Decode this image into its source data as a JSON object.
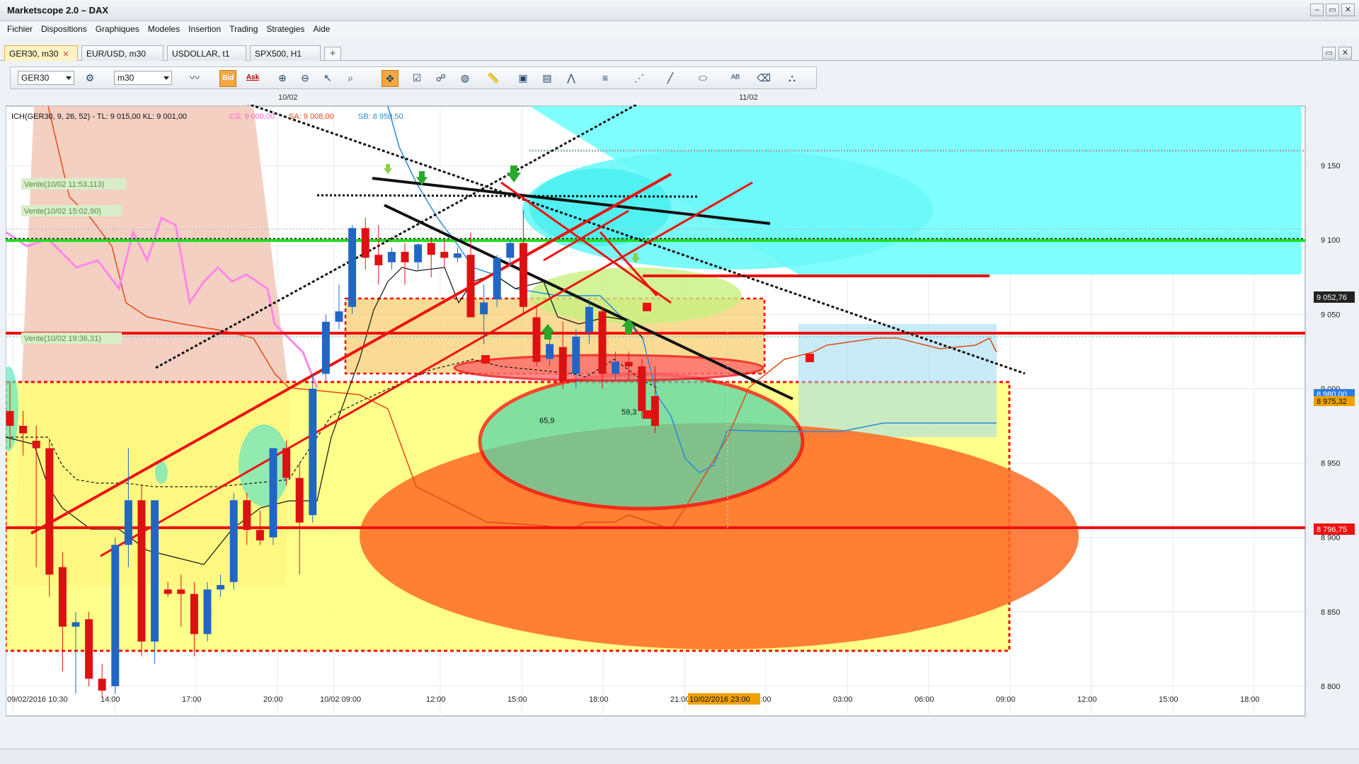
{
  "window": {
    "title": "Marketscope 2.0 – DAX"
  },
  "menu": [
    "Fichier",
    "Dispositions",
    "Graphiques",
    "Modeles",
    "Insertion",
    "Trading",
    "Strategies",
    "Aide"
  ],
  "tabs": [
    {
      "label": "GER30, m30",
      "close": "✕"
    },
    {
      "label": "EUR/USD, m30"
    },
    {
      "label": "USDOLLAR, t1"
    },
    {
      "label": "SPX500, H1"
    }
  ],
  "toolbar": {
    "instrument": "GER30",
    "timeframe": "m30",
    "bid_label": "Bid",
    "ask_label": "Ask"
  },
  "chart": {
    "indicator": "ICH(GER30, 9, 26, 52) -   TL: 9 015,00   KL: 9 001,00",
    "indicator_cs": "CS: 9 000,00",
    "indicator_sa": "SA: 9 008,00",
    "indicator_sb": "SB: 8 950,50",
    "date_markers": [
      "10/02",
      "11/02"
    ],
    "trade_labels": [
      "Vente(10/02 11:53,113)",
      "Vente(10/02 15:02,90)",
      "Vente(10/02 19:36,31)"
    ],
    "price_labels": [
      {
        "text": "9 052,76",
        "color": "#222222"
      },
      {
        "text": "8 980,00",
        "color": "#2a7de1"
      },
      {
        "text": "8 975,32",
        "color": "#f0a000"
      },
      {
        "text": "8 796,75",
        "color": "#ee1111"
      }
    ],
    "value_labels": [
      "65,9",
      "59,3"
    ],
    "cursor_time": "10/02/2016 23:00",
    "x_ticks": [
      "09/02/2016 10:30",
      "14:00",
      "17:00",
      "20:00",
      "10/02 09:00",
      "12:00",
      "15:00",
      "18:00",
      "21:00",
      "00:00",
      "03:00",
      "06:00",
      "09:00",
      "12:00",
      "15:00",
      "18:00"
    ],
    "y_ticks": [
      "9 150",
      "9 100",
      "9 050",
      "9 000",
      "8 950",
      "8 900",
      "8 850",
      "8 800"
    ],
    "ylim": [
      8780,
      9190
    ],
    "candles": [
      {
        "o": 8985,
        "h": 9005,
        "l": 8960,
        "c": 8975
      },
      {
        "o": 8975,
        "h": 8985,
        "l": 8955,
        "c": 8970
      },
      {
        "o": 8965,
        "h": 8975,
        "l": 8880,
        "c": 8960
      },
      {
        "o": 8960,
        "h": 8965,
        "l": 8860,
        "c": 8875
      },
      {
        "o": 8880,
        "h": 8890,
        "l": 8810,
        "c": 8840
      },
      {
        "o": 8840,
        "h": 8850,
        "l": 8795,
        "c": 8843
      },
      {
        "o": 8845,
        "h": 8850,
        "l": 8800,
        "c": 8805
      },
      {
        "o": 8805,
        "h": 8815,
        "l": 8793,
        "c": 8797
      },
      {
        "o": 8800,
        "h": 8900,
        "l": 8795,
        "c": 8895
      },
      {
        "o": 8895,
        "h": 8960,
        "l": 8880,
        "c": 8925
      },
      {
        "o": 8925,
        "h": 8935,
        "l": 8820,
        "c": 8830
      },
      {
        "o": 8830,
        "h": 8925,
        "l": 8815,
        "c": 8925
      },
      {
        "o": 8865,
        "h": 8870,
        "l": 8860,
        "c": 8862
      },
      {
        "o": 8865,
        "h": 8875,
        "l": 8840,
        "c": 8862
      },
      {
        "o": 8862,
        "h": 8870,
        "l": 8820,
        "c": 8835
      },
      {
        "o": 8835,
        "h": 8870,
        "l": 8830,
        "c": 8865
      },
      {
        "o": 8865,
        "h": 8875,
        "l": 8860,
        "c": 8868
      },
      {
        "o": 8870,
        "h": 8930,
        "l": 8865,
        "c": 8925
      },
      {
        "o": 8925,
        "h": 8930,
        "l": 8895,
        "c": 8905
      },
      {
        "o": 8905,
        "h": 8918,
        "l": 8895,
        "c": 8898
      },
      {
        "o": 8900,
        "h": 8960,
        "l": 8895,
        "c": 8960
      },
      {
        "o": 8960,
        "h": 8965,
        "l": 8935,
        "c": 8940
      },
      {
        "o": 8940,
        "h": 8950,
        "l": 8875,
        "c": 8910
      },
      {
        "o": 8915,
        "h": 9010,
        "l": 8910,
        "c": 9000
      },
      {
        "o": 9010,
        "h": 9050,
        "l": 9005,
        "c": 9045
      },
      {
        "o": 9045,
        "h": 9070,
        "l": 9040,
        "c": 9052
      },
      {
        "o": 9055,
        "h": 9110,
        "l": 9050,
        "c": 9108
      },
      {
        "o": 9108,
        "h": 9115,
        "l": 9080,
        "c": 9088
      },
      {
        "o": 9090,
        "h": 9110,
        "l": 9070,
        "c": 9083
      },
      {
        "o": 9085,
        "h": 9095,
        "l": 9080,
        "c": 9092
      },
      {
        "o": 9092,
        "h": 9098,
        "l": 9070,
        "c": 9085
      },
      {
        "o": 9085,
        "h": 9098,
        "l": 9080,
        "c": 9097
      },
      {
        "o": 9098,
        "h": 9102,
        "l": 9075,
        "c": 9090
      },
      {
        "o": 9092,
        "h": 9100,
        "l": 9082,
        "c": 9088
      },
      {
        "o": 9088,
        "h": 9095,
        "l": 9085,
        "c": 9091
      },
      {
        "o": 9090,
        "h": 9105,
        "l": 9050,
        "c": 9048
      },
      {
        "o": 9050,
        "h": 9070,
        "l": 9030,
        "c": 9058
      },
      {
        "o": 9060,
        "h": 9090,
        "l": 9055,
        "c": 9088
      },
      {
        "o": 9088,
        "h": 9100,
        "l": 9082,
        "c": 9098
      },
      {
        "o": 9098,
        "h": 9120,
        "l": 9050,
        "c": 9055
      },
      {
        "o": 9048,
        "h": 9055,
        "l": 9015,
        "c": 9018
      },
      {
        "o": 9020,
        "h": 9035,
        "l": 9015,
        "c": 9030
      },
      {
        "o": 9028,
        "h": 9045,
        "l": 9000,
        "c": 9005
      },
      {
        "o": 9010,
        "h": 9040,
        "l": 9000,
        "c": 9035
      },
      {
        "o": 9038,
        "h": 9060,
        "l": 9030,
        "c": 9055
      },
      {
        "o": 9052,
        "h": 9055,
        "l": 9000,
        "c": 9010
      },
      {
        "o": 9010,
        "h": 9025,
        "l": 9005,
        "c": 9018
      },
      {
        "o": 9018,
        "h": 9025,
        "l": 9005,
        "c": 9015
      },
      {
        "o": 9015,
        "h": 9020,
        "l": 8980,
        "c": 8985
      },
      {
        "o": 8995,
        "h": 9015,
        "l": 8970,
        "c": 8975
      }
    ]
  }
}
